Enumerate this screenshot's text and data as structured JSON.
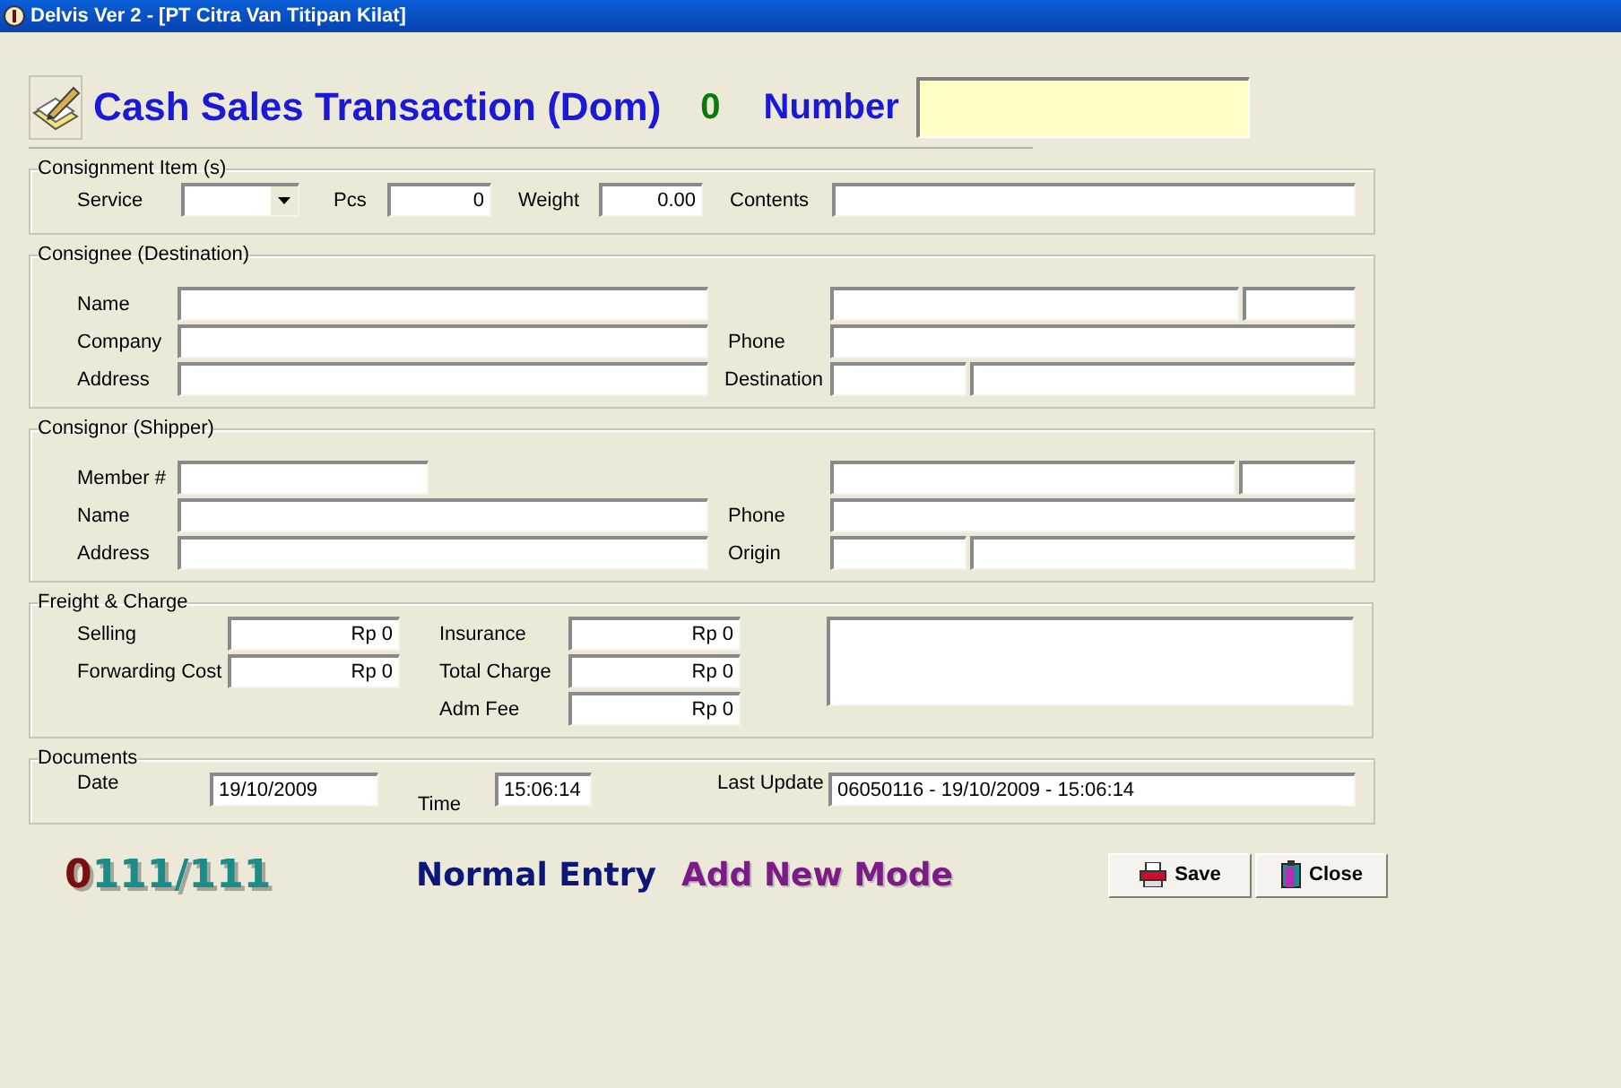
{
  "window": {
    "title": "Delvis Ver 2 - [PT Citra Van Titipan Kilat]"
  },
  "header": {
    "title": "Cash Sales Transaction (Dom)",
    "count": "0",
    "number_label": "Number"
  },
  "consignment_items": {
    "legend": "Consignment Item (s)",
    "service_label": "Service",
    "pcs_label": "Pcs",
    "pcs": "0",
    "weight_label": "Weight",
    "weight": "0.00",
    "contents_label": "Contents"
  },
  "consignee": {
    "legend": "Consignee (Destination)",
    "labels": [
      "Name",
      "Company",
      "Address"
    ],
    "phone_label": "Phone",
    "destination_label": "Destination"
  },
  "consignor": {
    "legend": "Consignor (Shipper)",
    "labels": [
      "Member #",
      "Name",
      "Address"
    ],
    "phone_label": "Phone",
    "origin_label": "Origin"
  },
  "freight": {
    "legend": "Freight & Charge",
    "left": [
      {
        "label": "Selling",
        "value": "Rp 0"
      },
      {
        "label": "Forwarding Cost",
        "value": "Rp 0"
      }
    ],
    "right": [
      {
        "label": "Insurance",
        "value": "Rp 0"
      },
      {
        "label": "Total Charge",
        "value": "Rp 0"
      },
      {
        "label": "Adm Fee",
        "value": "Rp 0"
      }
    ]
  },
  "documents": {
    "legend": "Documents",
    "date_label": "Date",
    "date": "19/10/2009",
    "time_label": "Time",
    "time": "15:06:14",
    "last_update_label": "Last Update",
    "last_update": "06050116 - 19/10/2009 - 15:06:14"
  },
  "status": {
    "record_prefix": "0",
    "record": "111/111",
    "entry": "Normal Entry",
    "mode": "Add New Mode"
  },
  "buttons": [
    {
      "label": "Save",
      "kind": "save"
    },
    {
      "label": "Close",
      "kind": "close"
    }
  ]
}
